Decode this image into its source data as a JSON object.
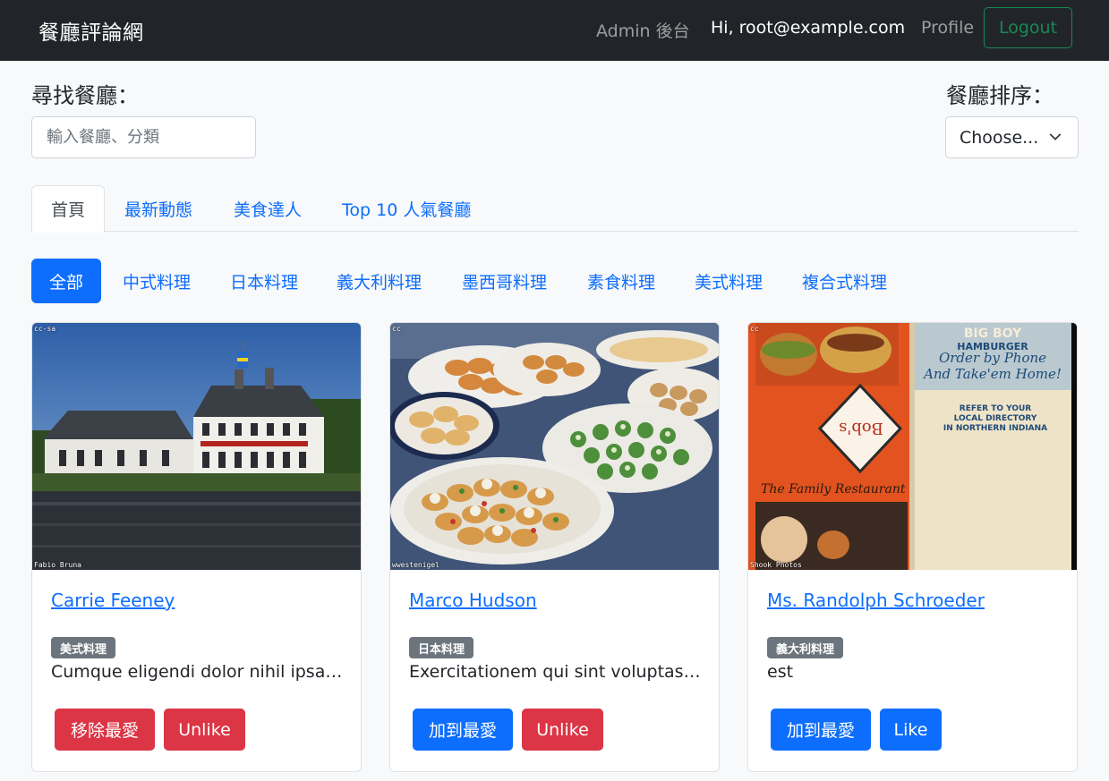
{
  "navbar": {
    "brand": "餐廳評論網",
    "admin_link": "Admin 後台",
    "greeting": "Hi, root@example.com",
    "profile_link": "Profile",
    "logout_label": "Logout"
  },
  "search": {
    "label": "尋找餐廳：",
    "placeholder": "輸入餐廳、分類"
  },
  "sort": {
    "label": "餐廳排序：",
    "selected": "Choose..."
  },
  "tabs": [
    "首頁",
    "最新動態",
    "美食達人",
    "Top 10 人氣餐廳"
  ],
  "categories": [
    "全部",
    "中式料理",
    "日本料理",
    "義大利料理",
    "墨西哥料理",
    "素食料理",
    "美式料理",
    "複合式料理"
  ],
  "restaurants": [
    {
      "name": "Carrie Feeney",
      "category": "美式料理",
      "description": "Cumque eligendi dolor nihil ipsa quia",
      "image_license": "cc-sa",
      "image_credit": "Fabio Bruna",
      "favorite_label": "移除最愛",
      "like_label": "Unlike"
    },
    {
      "name": "Marco Hudson",
      "category": "日本料理",
      "description": "Exercitationem qui sint voluptas. Et",
      "image_license": "cc",
      "image_credit": "wwestenigel",
      "favorite_label": "加到最愛",
      "like_label": "Unlike"
    },
    {
      "name": "Ms. Randolph Schroeder",
      "category": "義大利料理",
      "description": "est",
      "image_license": "cc",
      "image_credit": "Shook Photos",
      "favorite_label": "加到最愛",
      "like_label": "Like"
    }
  ],
  "colors": {
    "navbar_bg": "#212529",
    "primary": "#0d6efd",
    "danger": "#dc3545",
    "success": "#198754",
    "badge": "#6c757d"
  }
}
